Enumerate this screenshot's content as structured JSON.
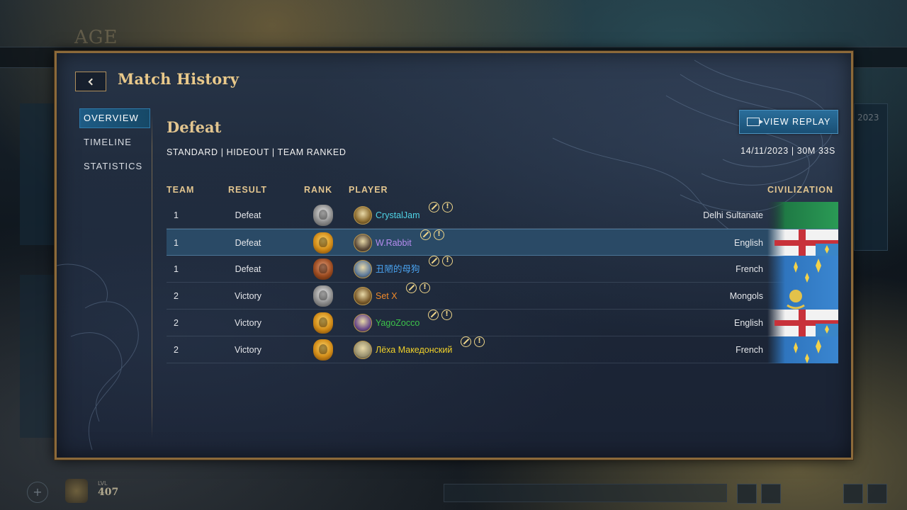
{
  "background": {
    "logo_text": "AGE",
    "right_panel_text": "2023",
    "level_label": "LVL",
    "level_value": "407"
  },
  "modal": {
    "title": "Match History",
    "nav": [
      {
        "label": "OVERVIEW",
        "active": true
      },
      {
        "label": "TIMELINE",
        "active": false
      },
      {
        "label": "STATISTICS",
        "active": false
      }
    ],
    "result_heading": "Defeat",
    "match_meta": "STANDARD | HIDEOUT | TEAM RANKED",
    "match_date": "14/11/2023 | 30M 33S",
    "replay_button": "VIEW REPLAY",
    "columns": {
      "team": "TEAM",
      "result": "RESULT",
      "rank": "RANK",
      "player": "PLAYER",
      "civilization": "CIVILIZATION"
    },
    "rows": [
      {
        "team": "1",
        "result": "Defeat",
        "rank_tier": "silver",
        "player": "CrystalJam",
        "player_color": "#4fd3e6",
        "civilization": "Delhi Sultanate",
        "flag": "delhi",
        "avatar": "#8a6a2e",
        "selected": false
      },
      {
        "team": "1",
        "result": "Defeat",
        "rank_tier": "gold",
        "player": "W.Rabbit",
        "player_color": "#b68cf0",
        "civilization": "English",
        "flag": "english",
        "avatar": "#5a4a3a",
        "selected": true
      },
      {
        "team": "1",
        "result": "Defeat",
        "rank_tier": "bronze",
        "player": "丑陋的母狗",
        "player_color": "#4aa3f0",
        "civilization": "French",
        "flag": "french",
        "avatar": "#5e7a9a",
        "selected": false
      },
      {
        "team": "2",
        "result": "Victory",
        "rank_tier": "silver",
        "player": "Set X",
        "player_color": "#f0892a",
        "civilization": "Mongols",
        "flag": "mongols",
        "avatar": "#7a5a2a",
        "selected": false
      },
      {
        "team": "2",
        "result": "Victory",
        "rank_tier": "gold",
        "player": "YagoZocco",
        "player_color": "#3cc24a",
        "civilization": "English",
        "flag": "english",
        "avatar": "#6a4a8a",
        "selected": false
      },
      {
        "team": "2",
        "result": "Victory",
        "rank_tier": "gold",
        "player": "Лёха Македонский",
        "player_color": "#f0d12a",
        "civilization": "French",
        "flag": "french",
        "avatar": "#9a9270",
        "selected": false
      }
    ]
  },
  "colors": {
    "accent_gold": "#e2c58f",
    "nav_active": "#1e5c86",
    "selected_row": "#2a4a66"
  }
}
